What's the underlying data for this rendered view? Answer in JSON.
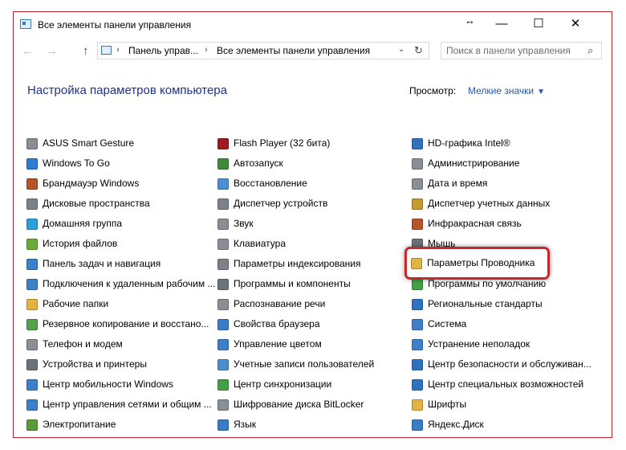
{
  "window": {
    "title": "Все элементы панели управления",
    "resize_glyph": "↔",
    "controls": {
      "minimize": "—",
      "maximize": "☐",
      "close": "✕"
    }
  },
  "nav": {
    "back": "←",
    "forward": "→",
    "up": "↑",
    "breadcrumb": [
      "Панель управ...",
      "Все элементы панели управления"
    ],
    "separator": "›",
    "dropdown": "⌄",
    "refresh": "↻",
    "search_placeholder": "Поиск в панели управления",
    "search_icon": "⌕"
  },
  "header": {
    "title": "Настройка параметров компьютера",
    "view_label": "Просмотр:",
    "view_value": "Мелкие значки",
    "view_caret": "▼"
  },
  "columns": [
    [
      {
        "label": "ASUS Smart Gesture",
        "icon": "touchpad-icon",
        "color": "#8a8f96"
      },
      {
        "label": "Windows To Go",
        "icon": "usb-drive-icon",
        "color": "#2f7bd3"
      },
      {
        "label": "Брандмауэр Windows",
        "icon": "firewall-icon",
        "color": "#b5532a"
      },
      {
        "label": "Дисковые пространства",
        "icon": "storage-icon",
        "color": "#7c8288"
      },
      {
        "label": "Домашняя группа",
        "icon": "homegroup-icon",
        "color": "#2aa0d8"
      },
      {
        "label": "История файлов",
        "icon": "file-history-icon",
        "color": "#6bab3a"
      },
      {
        "label": "Панель задач и навигация",
        "icon": "taskbar-icon",
        "color": "#3d7fc9"
      },
      {
        "label": "Подключения к удаленным рабочим ...",
        "icon": "remote-desktop-icon",
        "color": "#3d7fc9"
      },
      {
        "label": "Рабочие папки",
        "icon": "work-folders-icon",
        "color": "#e3b342"
      },
      {
        "label": "Резервное копирование и восстано...",
        "icon": "backup-icon",
        "color": "#55a04a"
      },
      {
        "label": "Телефон и модем",
        "icon": "phone-modem-icon",
        "color": "#8a8f96"
      },
      {
        "label": "Устройства и принтеры",
        "icon": "printer-icon",
        "color": "#6a737b"
      },
      {
        "label": "Центр мобильности Windows",
        "icon": "mobility-icon",
        "color": "#3d7fc9"
      },
      {
        "label": "Центр управления сетями и общим ...",
        "icon": "network-icon",
        "color": "#3d7fc9"
      },
      {
        "label": "Электропитание",
        "icon": "power-icon",
        "color": "#5a9a3a"
      }
    ],
    [
      {
        "label": "Flash Player (32 бита)",
        "icon": "flash-icon",
        "color": "#9e1b1b"
      },
      {
        "label": "Автозапуск",
        "icon": "autoplay-icon",
        "color": "#3d8a3a"
      },
      {
        "label": "Восстановление",
        "icon": "recovery-icon",
        "color": "#4b8fd0"
      },
      {
        "label": "Диспетчер устройств",
        "icon": "device-manager-icon",
        "color": "#7c8288"
      },
      {
        "label": "Звук",
        "icon": "speaker-icon",
        "color": "#8a8f96"
      },
      {
        "label": "Клавиатура",
        "icon": "keyboard-icon",
        "color": "#8a8f96"
      },
      {
        "label": "Параметры индексирования",
        "icon": "indexing-icon",
        "color": "#7c8288"
      },
      {
        "label": "Программы и компоненты",
        "icon": "programs-icon",
        "color": "#6a737b"
      },
      {
        "label": "Распознавание речи",
        "icon": "microphone-icon",
        "color": "#8a8f96"
      },
      {
        "label": "Свойства браузера",
        "icon": "browser-icon",
        "color": "#3a7cc7"
      },
      {
        "label": "Управление цветом",
        "icon": "color-management-icon",
        "color": "#3d7fc9"
      },
      {
        "label": "Учетные записи пользователей",
        "icon": "users-icon",
        "color": "#4a8fcc"
      },
      {
        "label": "Центр синхронизации",
        "icon": "sync-icon",
        "color": "#44a047"
      },
      {
        "label": "Шифрование диска BitLocker",
        "icon": "bitlocker-icon",
        "color": "#8a8f96"
      },
      {
        "label": "Язык",
        "icon": "language-icon",
        "color": "#3a7cc7"
      }
    ],
    [
      {
        "label": "HD-графика Intel®",
        "icon": "intel-graphics-icon",
        "color": "#2f73c0"
      },
      {
        "label": "Администрирование",
        "icon": "admin-tools-icon",
        "color": "#8a8f96"
      },
      {
        "label": "Дата и время",
        "icon": "clock-icon",
        "color": "#8a8f96"
      },
      {
        "label": "Диспетчер учетных данных",
        "icon": "credential-icon",
        "color": "#c79a2e"
      },
      {
        "label": "Инфракрасная связь",
        "icon": "infrared-icon",
        "color": "#b5532a"
      },
      {
        "label": "Мышь",
        "icon": "mouse-icon",
        "color": "#6a737b"
      },
      {
        "label": "Параметры Проводника",
        "icon": "folder-options-icon",
        "color": "#e3b342"
      },
      {
        "label": "Программы по умолчанию",
        "icon": "default-programs-icon",
        "color": "#44a047"
      },
      {
        "label": "Региональные стандарты",
        "icon": "region-icon",
        "color": "#2f73c0"
      },
      {
        "label": "Система",
        "icon": "system-icon",
        "color": "#3d7fc9"
      },
      {
        "label": "Устранение неполадок",
        "icon": "troubleshoot-icon",
        "color": "#3d7fc9"
      },
      {
        "label": "Центр безопасности и обслуживан...",
        "icon": "security-flag-icon",
        "color": "#2f73c0"
      },
      {
        "label": "Центр специальных возможностей",
        "icon": "accessibility-icon",
        "color": "#2f73c0"
      },
      {
        "label": "Шрифты",
        "icon": "fonts-icon",
        "color": "#e3b342"
      },
      {
        "label": "Яндекс.Диск",
        "icon": "yandex-disk-icon",
        "color": "#3a7cc7"
      }
    ]
  ],
  "colors": {
    "accent_red": "#c8282c",
    "heading_blue": "#1e3287",
    "link_blue": "#1e5bb9"
  }
}
